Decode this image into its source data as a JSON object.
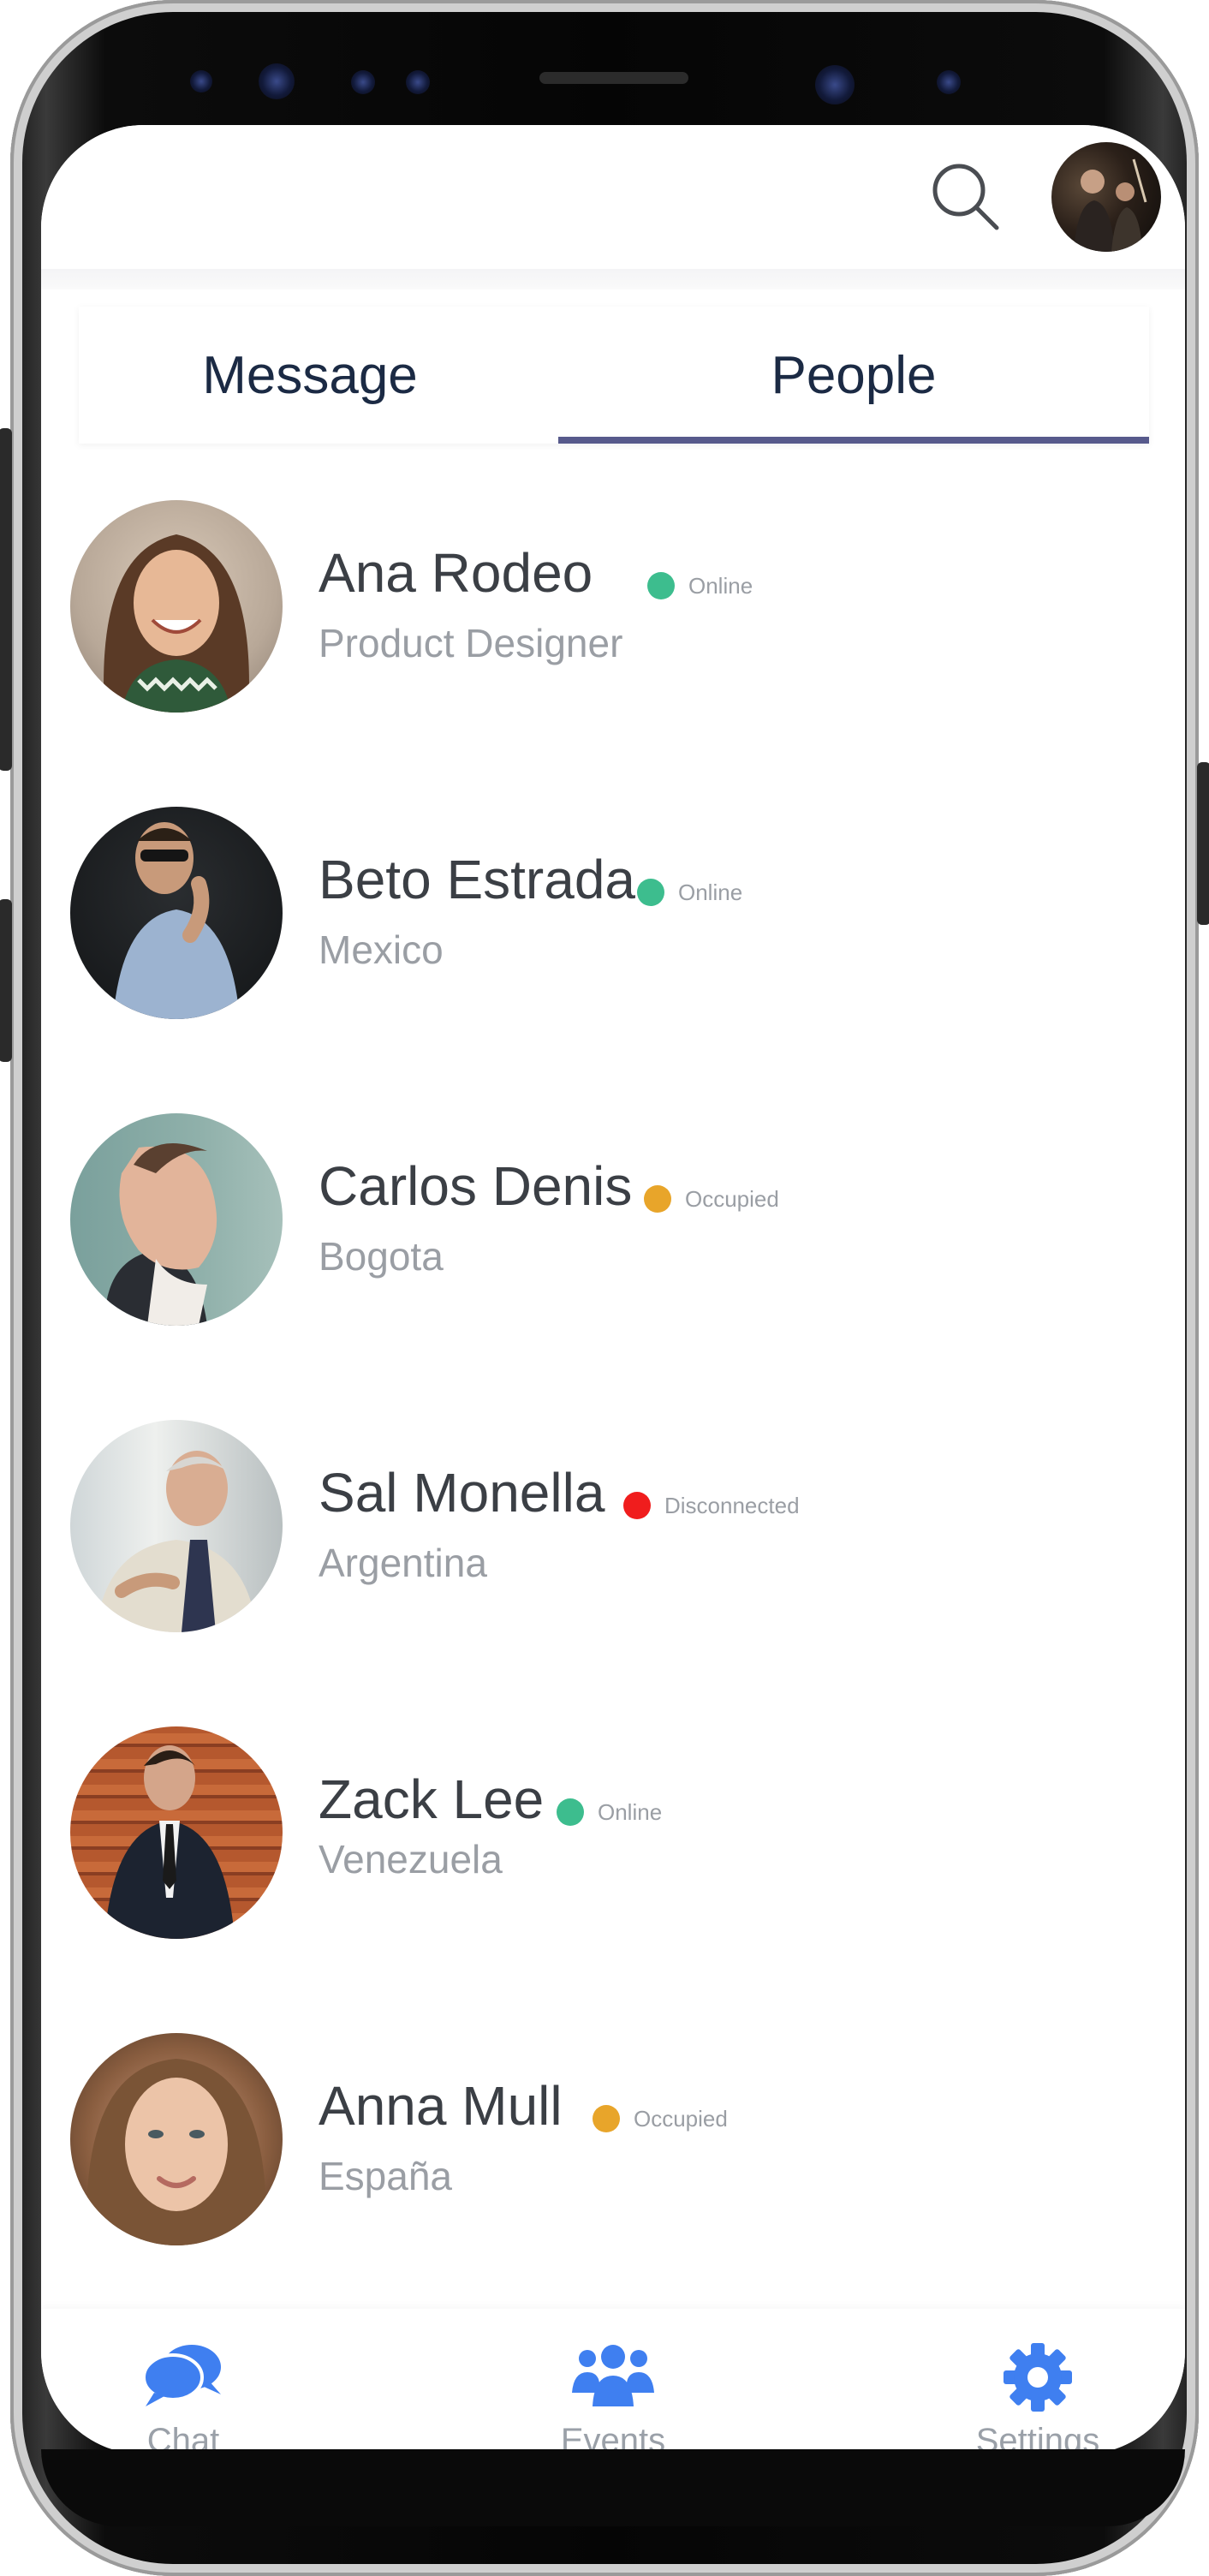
{
  "tabs": {
    "message": "Message",
    "people": "People",
    "active": "People"
  },
  "people": [
    {
      "name": "Ana Rodeo",
      "subtitle": "Product Designer",
      "status": "Online",
      "status_color": "#3dbd8e",
      "icon": "avatar-woman-curly-hair"
    },
    {
      "name": "Beto Estrada",
      "subtitle": "Mexico",
      "status": "Online",
      "status_color": "#3dbd8e",
      "icon": "avatar-man-sunglasses"
    },
    {
      "name": "Carlos Denis",
      "subtitle": "Bogota",
      "status": "Occupied",
      "status_color": "#e8a52a",
      "icon": "avatar-man-profile"
    },
    {
      "name": "Sal Monella",
      "subtitle": "Argentina",
      "status": "Disconnected",
      "status_color": "#f01d1d",
      "icon": "avatar-man-tie"
    },
    {
      "name": "Zack Lee",
      "subtitle": "Venezuela",
      "status": "Online",
      "status_color": "#3dbd8e",
      "icon": "avatar-man-suit"
    },
    {
      "name": "Anna Mull",
      "subtitle": "España",
      "status": "Occupied",
      "status_color": "#e8a52a",
      "icon": "avatar-woman-smiling"
    }
  ],
  "nav": [
    {
      "label": "Chat",
      "icon": "chat-bubbles-icon"
    },
    {
      "label": "Events",
      "icon": "group-icon"
    },
    {
      "label": "Settings",
      "icon": "gear-icon"
    }
  ],
  "colors": {
    "accent": "#3f7ff0",
    "tab_underline": "#575a8c",
    "title_text": "#1b2a44"
  }
}
